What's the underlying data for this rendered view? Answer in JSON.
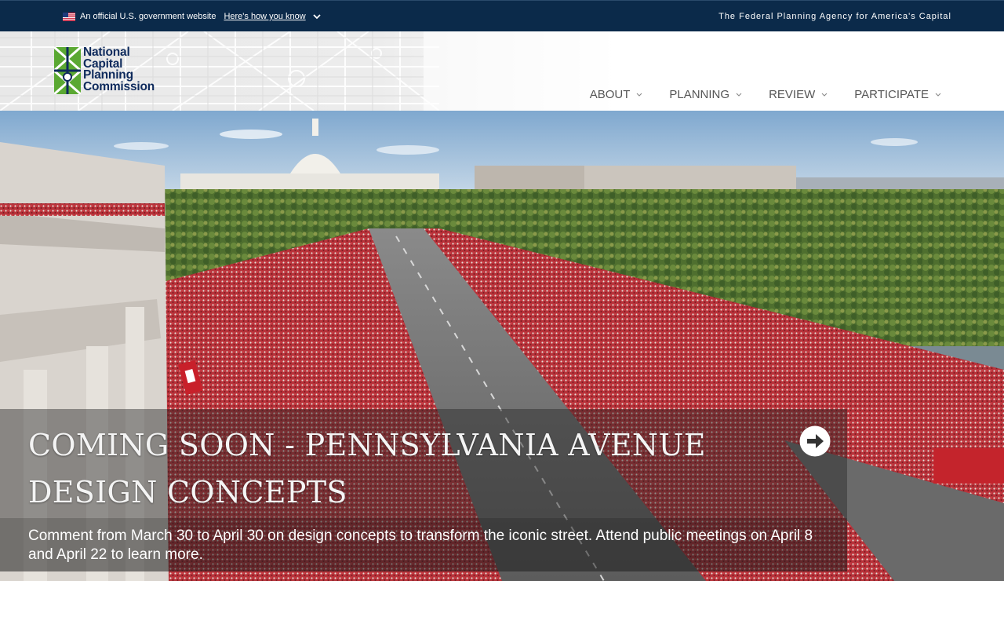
{
  "gov_banner": {
    "official_text": "An official U.S. government website",
    "how_you_know": "Here's how you know",
    "tagline": "The Federal Planning Agency for America's Capital"
  },
  "logo": {
    "line1": "National",
    "line2": "Capital",
    "line3": "Planning",
    "line4": "Commission"
  },
  "nav": {
    "items": [
      {
        "label": "ABOUT"
      },
      {
        "label": "PLANNING"
      },
      {
        "label": "REVIEW"
      },
      {
        "label": "PARTICIPATE"
      }
    ]
  },
  "hero": {
    "title": "COMING SOON - PENNSYLVANIA AVENUE DESIGN CONCEPTS",
    "description": "Comment from March 30 to April 30 on design concepts to transform the iconic street. Attend public meetings on April 8 and April 22 to learn more.",
    "arrow_icon": "arrow-right-circle-icon"
  },
  "colors": {
    "gov_banner_bg": "#0b2a4a",
    "logo_navy": "#0e2a5c",
    "logo_green": "#5aa832",
    "nav_text": "#555555"
  }
}
